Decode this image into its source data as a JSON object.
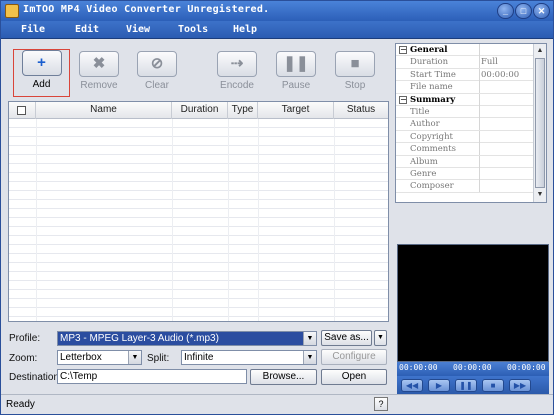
{
  "window": {
    "title": "ImTOO MP4 Video Converter Unregistered."
  },
  "menu": [
    "File",
    "Edit",
    "View",
    "Tools",
    "Help"
  ],
  "toolbar": {
    "add": "Add",
    "remove": "Remove",
    "clear": "Clear",
    "encode": "Encode",
    "pause": "Pause",
    "stop": "Stop"
  },
  "icons": {
    "add": "+",
    "remove": "✖",
    "clear": "⊘",
    "encode": "⇢",
    "pause": "❚❚",
    "stop": "■"
  },
  "file_list": {
    "columns": [
      "Name",
      "Duration",
      "Type",
      "Target",
      "Status"
    ]
  },
  "profile": {
    "label": "Profile:",
    "value": "MP3 - MPEG Layer-3 Audio  (*.mp3)",
    "save_as": "Save as..."
  },
  "zoom": {
    "label": "Zoom:",
    "value": "Letterbox"
  },
  "split": {
    "label": "Split:",
    "value": "Infinite",
    "configure": "Configure"
  },
  "destination": {
    "label": "Destination:",
    "value": "C:\\Temp",
    "browse": "Browse...",
    "open": "Open"
  },
  "properties": {
    "general": {
      "title": "General",
      "rows": [
        {
          "key": "Duration",
          "value": "Full"
        },
        {
          "key": "Start Time",
          "value": "00:00:00"
        },
        {
          "key": "File name",
          "value": ""
        }
      ]
    },
    "summary": {
      "title": "Summary",
      "rows": [
        "Title",
        "Author",
        "Copyright",
        "Comments",
        "Album",
        "Genre",
        "Composer"
      ]
    }
  },
  "player": {
    "time_current": "00:00:00",
    "time_mid": "00:00:00",
    "time_total": "00:00:00"
  },
  "status": {
    "text": "Ready",
    "help": "?"
  }
}
